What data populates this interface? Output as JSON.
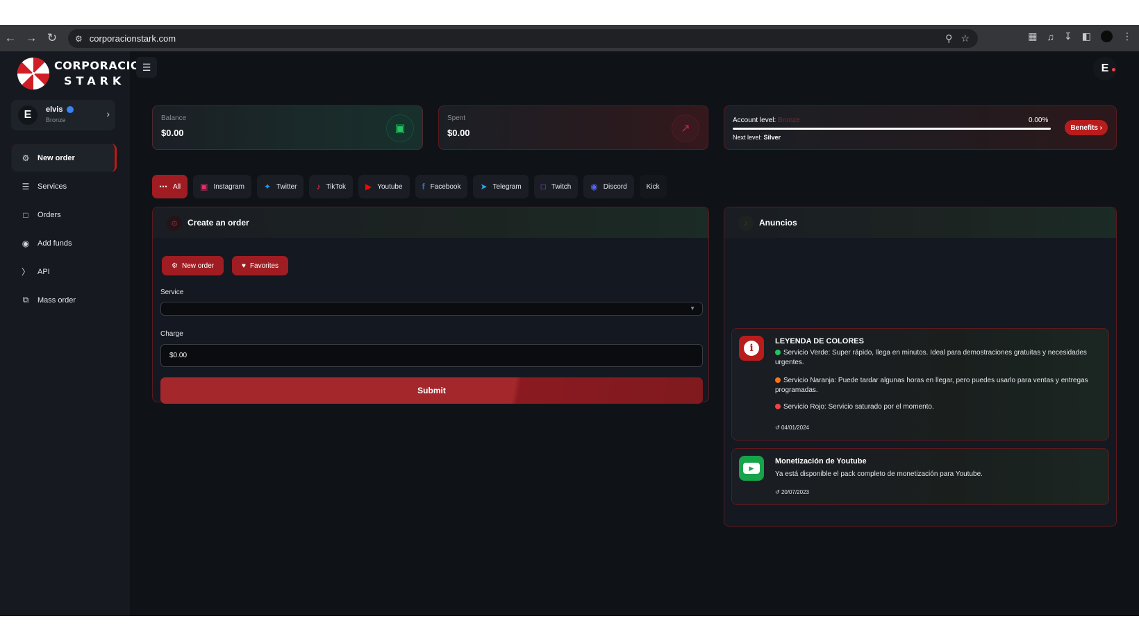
{
  "browser": {
    "url": "corporacionstark.com"
  },
  "brand": {
    "line1": "CORPORACION",
    "line2": "STARK",
    "accent": "#b91c1c"
  },
  "user": {
    "initial": "E",
    "name": "elvis",
    "rank": "Bronze"
  },
  "sidebar": {
    "items": [
      {
        "label": "New order",
        "icon": "new-order-icon",
        "active": true
      },
      {
        "label": "Services",
        "icon": "services-icon"
      },
      {
        "label": "Orders",
        "icon": "orders-icon"
      },
      {
        "label": "Add funds",
        "icon": "add-funds-icon"
      },
      {
        "label": "API",
        "icon": "api-icon"
      },
      {
        "label": "Mass order",
        "icon": "mass-order-icon"
      }
    ]
  },
  "stats": {
    "balance_label": "Balance",
    "balance_value": "$0.00",
    "spent_label": "Spent",
    "spent_value": "$0.00",
    "level_label": "Account level:",
    "level_rank": "Bronze",
    "level_percent": "0.00%",
    "level_progress": 0,
    "next_level_label": "Next level:",
    "next_level": "Silver",
    "benefits_label": "Benefits"
  },
  "tabs": [
    {
      "label": "All",
      "icon": "dots-icon",
      "active": true
    },
    {
      "label": "Instagram",
      "icon": "instagram-icon"
    },
    {
      "label": "Twitter",
      "icon": "twitter-icon"
    },
    {
      "label": "TikTok",
      "icon": "tiktok-icon"
    },
    {
      "label": "Youtube",
      "icon": "youtube-icon"
    },
    {
      "label": "Facebook",
      "icon": "facebook-icon"
    },
    {
      "label": "Telegram",
      "icon": "telegram-icon"
    },
    {
      "label": "Twitch",
      "icon": "twitch-icon"
    },
    {
      "label": "Discord",
      "icon": "discord-icon"
    },
    {
      "label": "Kick",
      "icon": ""
    }
  ],
  "order": {
    "title": "Create an order",
    "new_order_label": "New order",
    "favorites_label": "Favorites",
    "service_label": "Service",
    "service_value": "",
    "charge_label": "Charge",
    "charge_value": "$0.00",
    "submit_label": "Submit"
  },
  "announcements": {
    "title": "Anuncios",
    "items": [
      {
        "title": "LEYENDA DE COLORES",
        "lines": [
          {
            "color": "#22c55e",
            "text": "Servicio Verde: Super rápido, llega en minutos. Ideal para demostraciones gratuitas y necesidades urgentes."
          },
          {
            "color": "#f97316",
            "text": "Servicio Naranja: Puede tardar algunas horas en llegar, pero puedes usarlo para ventas y entregas programadas."
          },
          {
            "color": "#ef4444",
            "text": "Servicio Rojo: Servicio saturado por el momento."
          }
        ],
        "date": "04/01/2024"
      },
      {
        "title": "Monetización de Youtube",
        "text": "Ya está disponible el pack completo de monetización para Youtube.",
        "date": "20/07/2023"
      }
    ]
  }
}
